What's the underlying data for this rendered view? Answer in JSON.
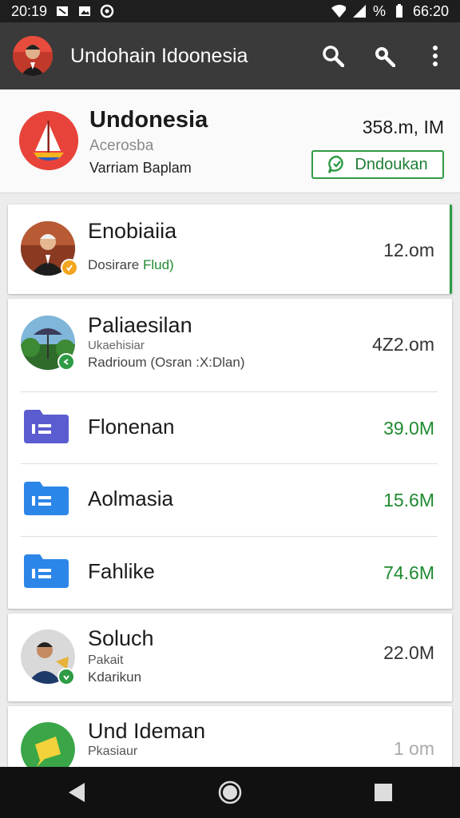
{
  "status": {
    "time": "20:19",
    "battery": "%",
    "clock_right": "66:20"
  },
  "app_bar": {
    "title": "Undohain Idoonesia"
  },
  "header": {
    "title": "Undonesia",
    "subtitle": "Acerosba",
    "developer": "Varriam Baplam",
    "size": "358.m, IM",
    "download_label": "Dndoukan"
  },
  "items": [
    {
      "name": "Enobiaiia",
      "sub1": "Dosirare",
      "sub1_accent": "Flud)",
      "sub2": "",
      "size": "12.om",
      "size_green": false,
      "badge_color": "#f2a51f"
    },
    {
      "name": "Paliaesilan",
      "sub1": "Ukaehisiar",
      "sub2": "Radrioum (Osran :X:Dlan)",
      "size": "4Z2.om",
      "size_green": false,
      "badge_color": "#2e9b45"
    },
    {
      "name": "Flonenan",
      "size": "39.0M",
      "size_green": true,
      "folder_color": "#5b5ccf"
    },
    {
      "name": "Aolmasia",
      "size": "15.6M",
      "size_green": true,
      "folder_color": "#2c86e8"
    },
    {
      "name": "Fahlike",
      "size": "74.6M",
      "size_green": true,
      "folder_color": "#2c86e8"
    },
    {
      "name": "Soluch",
      "sub1": "Pakait",
      "sub2": "Kdarikun",
      "size": "22.0M",
      "size_green": false,
      "badge_color": "#2e9b45"
    },
    {
      "name": "Und Ideman",
      "sub1": "Pkasiaur",
      "sub2": "",
      "size": "1 om",
      "size_green": false
    }
  ],
  "colors": {
    "accent_green": "#2e9b45",
    "app_bar": "#3a3a3a",
    "logo_red": "#e8433a"
  },
  "icons": [
    "search-icon",
    "search-icon-alt",
    "more-vert-icon",
    "back-icon",
    "home-icon",
    "recents-icon"
  ]
}
